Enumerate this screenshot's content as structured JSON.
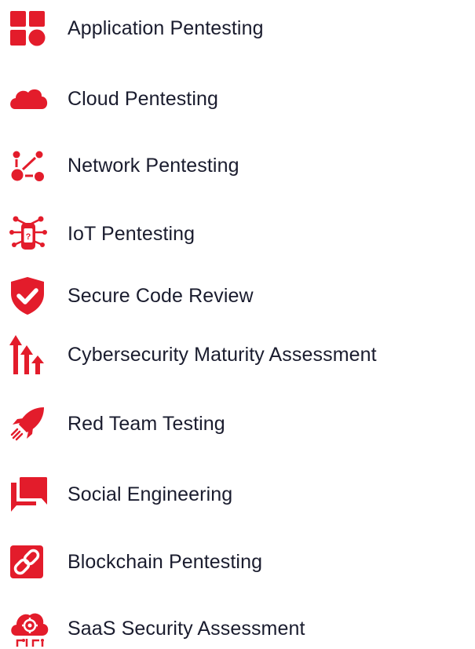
{
  "accent_color": "#e31c2b",
  "text_color": "#1a1c2e",
  "items": [
    {
      "label": "Application Pentesting",
      "icon": "grid-icon"
    },
    {
      "label": "Cloud Pentesting",
      "icon": "cloud-icon"
    },
    {
      "label": "Network Pentesting",
      "icon": "network-icon"
    },
    {
      "label": "IoT Pentesting",
      "icon": "iot-device-icon"
    },
    {
      "label": "Secure Code Review",
      "icon": "shield-check-icon"
    },
    {
      "label": "Cybersecurity Maturity Assessment",
      "icon": "growth-arrows-icon"
    },
    {
      "label": "Red Team Testing",
      "icon": "rocket-icon"
    },
    {
      "label": "Social Engineering",
      "icon": "chat-bubbles-icon"
    },
    {
      "label": "Blockchain Pentesting",
      "icon": "chain-link-icon"
    },
    {
      "label": "SaaS Security Assessment",
      "icon": "cloud-gear-icon"
    }
  ]
}
